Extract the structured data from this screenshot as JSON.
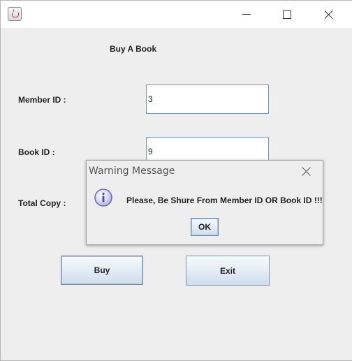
{
  "window": {
    "app_icon": "java-cup-icon",
    "controls": [
      "minimize-icon",
      "maximize-icon",
      "close-icon"
    ]
  },
  "form": {
    "heading": "Buy A Book",
    "member_id_label": "Member ID :",
    "member_id_value": "3",
    "book_id_label": "Book ID :",
    "book_id_value": "9",
    "total_copy_label": "Total Copy :"
  },
  "buttons": {
    "buy": "Buy",
    "exit": "Exit"
  },
  "dialog": {
    "title": "Warning Message",
    "icon": "info-icon",
    "message": "Please, Be Shure From Member ID OR Book ID !!!",
    "ok": "OK"
  },
  "colors": {
    "window_bg": "#eeeeee",
    "field_border": "#7a96b4",
    "info_icon": "#6b67c4"
  }
}
